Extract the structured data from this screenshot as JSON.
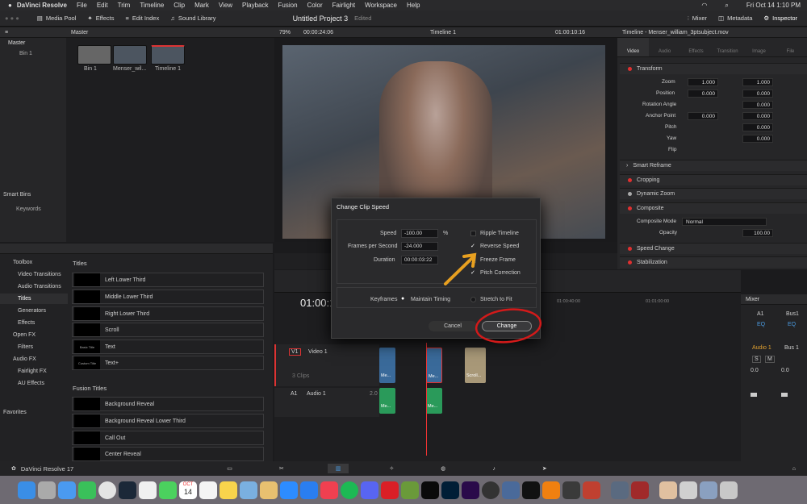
{
  "menubar": {
    "app": "DaVinci Resolve",
    "items": [
      "File",
      "Edit",
      "Trim",
      "Timeline",
      "Clip",
      "Mark",
      "View",
      "Playback",
      "Fusion",
      "Color",
      "Fairlight",
      "Workspace",
      "Help"
    ],
    "datetime": "Fri Oct 14  1:10 PM"
  },
  "toolbar": {
    "media_pool": "Media Pool",
    "effects": "Effects",
    "edit_index": "Edit Index",
    "sound_library": "Sound Library",
    "project": "Untitled Project 3",
    "edited": "Edited",
    "mixer": "Mixer",
    "metadata": "Metadata",
    "inspector": "Inspector"
  },
  "media": {
    "master": "Master",
    "tree_master": "Master",
    "tree_bin": "Bin 1",
    "clips": [
      "Bin 1",
      "Menser_wil...",
      "Timeline 1"
    ],
    "smart_bins": "Smart Bins",
    "keywords": "Keywords"
  },
  "viewer": {
    "zoom": "79%",
    "timecode": "00:00:24:06",
    "timeline": "Timeline 1",
    "tc_right": "01:00:10:16"
  },
  "inspector": {
    "title": "Timeline - Menser_william_3ptsubject.mov",
    "tabs": [
      "Video",
      "Audio",
      "Effects",
      "Transition",
      "Image",
      "File"
    ],
    "transform": "Transform",
    "zoom_label": "Zoom",
    "zoom_x": "1.000",
    "zoom_y": "1.000",
    "position_label": "Position",
    "pos_x": "0.000",
    "pos_y": "0.000",
    "rotation_label": "Rotation Angle",
    "rotation": "0.000",
    "anchor_label": "Anchor Point",
    "anchor_x": "0.000",
    "anchor_y": "0.000",
    "pitch_label": "Pitch",
    "pitch": "0.000",
    "yaw_label": "Yaw",
    "yaw": "0.000",
    "flip_label": "Flip",
    "smart_reframe": "Smart Reframe",
    "cropping": "Cropping",
    "dynamic_zoom": "Dynamic Zoom",
    "composite": "Composite",
    "comp_mode_label": "Composite Mode",
    "comp_mode": "Normal",
    "opacity_label": "Opacity",
    "opacity": "100.00",
    "speed_change": "Speed Change",
    "stabilization": "Stabilization"
  },
  "effects": {
    "toolbox": "Toolbox",
    "items": [
      "Video Transitions",
      "Audio Transitions",
      "Titles",
      "Generators",
      "Effects"
    ],
    "open_fx": "Open FX",
    "filters": "Filters",
    "audio_fx": "Audio FX",
    "fairlight_fx": "Fairlight FX",
    "au_effects": "AU Effects",
    "favorites": "Favorites",
    "titles_header": "Titles",
    "titles": [
      "Left Lower Third",
      "Middle Lower Third",
      "Right Lower Third",
      "Scroll",
      "Text",
      "Text+"
    ],
    "thumb_text": "Basic Title",
    "thumb_text2": "Custom Title",
    "fusion_header": "Fusion Titles",
    "fusion": [
      "Background Reveal",
      "Background Reveal Lower Third",
      "Call Out",
      "Center Reveal"
    ]
  },
  "timeline": {
    "tc": "01:00:1",
    "video1": "Video 1",
    "v1": "V1",
    "clips_count": "3 Clips",
    "audio1": "Audio 1",
    "a1": "A1",
    "a1_num": "2.0",
    "ruler": [
      "01:00:40:00",
      "01:01:00:00"
    ],
    "clip_me": "Me...",
    "clip_scroll": "Scroll..."
  },
  "mixer": {
    "title": "Mixer",
    "a1": "A1",
    "bus1": "Bus1",
    "eq": "EQ",
    "audio1": "Audio 1",
    "bus1b": "Bus 1",
    "s": "S",
    "m": "M",
    "level": "0.0"
  },
  "dialog": {
    "title": "Change Clip Speed",
    "speed_label": "Speed",
    "speed": "-100.00",
    "pct": "%",
    "fps_label": "Frames per Second",
    "fps": "-24.000",
    "duration_label": "Duration",
    "duration": "00:00:03:22",
    "ripple": "Ripple Timeline",
    "reverse": "Reverse Speed",
    "freeze": "Freeze Frame",
    "pitch": "Pitch Correction",
    "keyframes": "Keyframes",
    "maintain": "Maintain Timing",
    "stretch": "Stretch to Fit",
    "cancel": "Cancel",
    "change": "Change"
  },
  "bottom": {
    "app_label": "DaVinci Resolve 17"
  },
  "dock": {
    "calendar_month": "OCT",
    "calendar_day": "14"
  }
}
